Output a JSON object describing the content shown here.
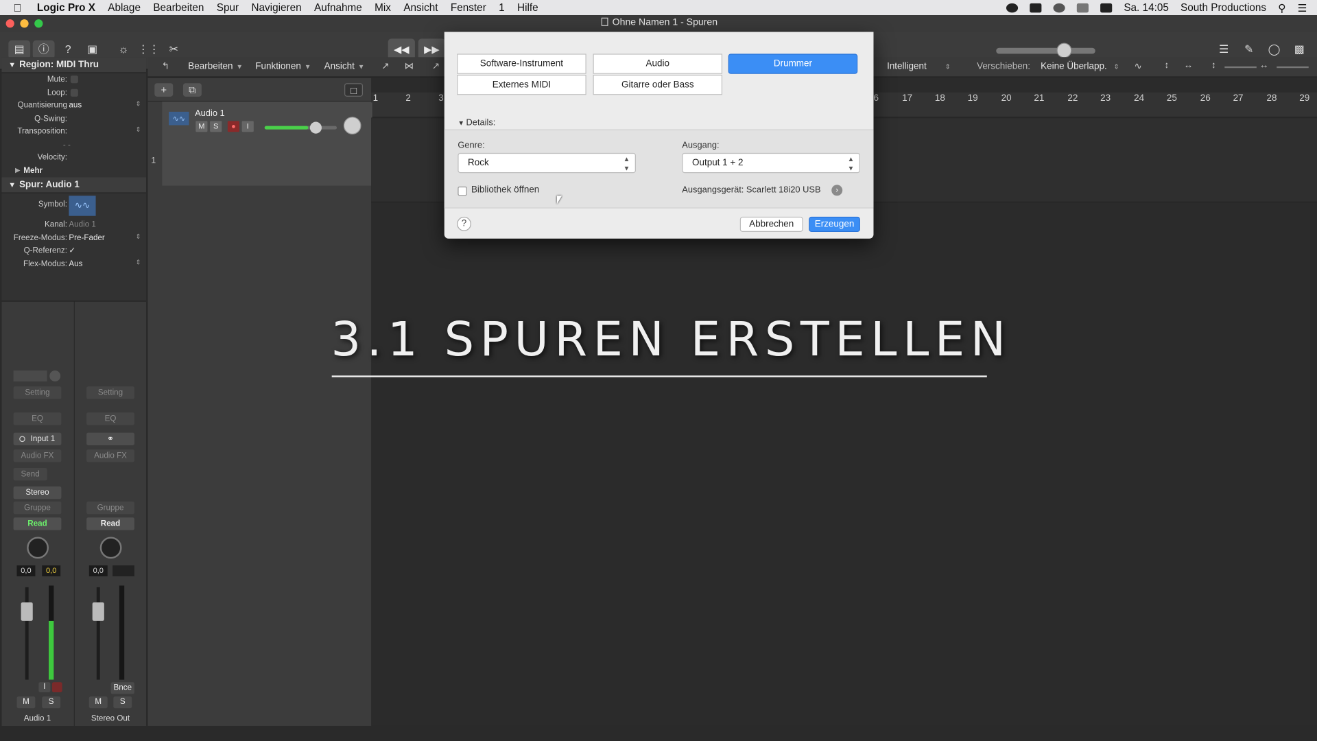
{
  "menubar": {
    "items": [
      "Logic Pro X",
      "Ablage",
      "Bearbeiten",
      "Spur",
      "Navigieren",
      "Aufnahme",
      "Mix",
      "Ansicht",
      "Fenster",
      "1",
      "Hilfe"
    ],
    "clock": "Sa. 14:05",
    "user": "South Productions"
  },
  "window": {
    "title": "Ohne Namen 1 - Spuren"
  },
  "inspector": {
    "region_header": "Region: MIDI Thru",
    "region_rows": [
      {
        "label": "Mute:",
        "value": ""
      },
      {
        "label": "Loop:",
        "value": ""
      },
      {
        "label": "Quantisierung",
        "value": "aus"
      },
      {
        "label": "Q-Swing:",
        "value": ""
      },
      {
        "label": "Transposition:",
        "value": ""
      },
      {
        "label": "",
        "value": "- -"
      },
      {
        "label": "Velocity:",
        "value": ""
      }
    ],
    "more": "Mehr",
    "track_header": "Spur: Audio 1",
    "symbol_label": "Symbol:",
    "track_rows": [
      {
        "label": "Kanal:",
        "value": "Audio 1"
      },
      {
        "label": "Freeze-Modus:",
        "value": "Pre-Fader"
      },
      {
        "label": "Q-Referenz:",
        "value": "✓"
      },
      {
        "label": "Flex-Modus:",
        "value": "Aus"
      }
    ]
  },
  "strips": {
    "setting": "Setting",
    "eq": "EQ",
    "input": "Input 1",
    "audio_fx": "Audio FX",
    "send": "Send",
    "stereo": "Stereo",
    "gruppe": "Gruppe",
    "read": "Read",
    "vol_a": "0,0",
    "pan_a": "0,0",
    "vol_b": "0,0",
    "bnce": "Bnce",
    "m": "M",
    "s": "S",
    "i": "I",
    "name_a": "Audio 1",
    "name_b": "Stereo Out"
  },
  "tracks_header": {
    "menus": [
      "Bearbeiten",
      "Funktionen",
      "Ansicht"
    ],
    "snap_value": "Intelligent",
    "drag_label": "Verschieben:",
    "drag_value": "Keine Überlapp."
  },
  "track": {
    "number": "1",
    "name": "Audio 1",
    "m": "M",
    "s": "S",
    "i": "I"
  },
  "ruler": {
    "left_bars": [
      "1",
      "2",
      "3"
    ],
    "right_bars": [
      "6",
      "17",
      "18",
      "19",
      "20",
      "21",
      "22",
      "23",
      "24",
      "25",
      "26",
      "27",
      "28",
      "29"
    ]
  },
  "overlay": {
    "title": "3.1 SPUREN ERSTELLEN"
  },
  "dialog": {
    "types": [
      "Software-Instrument",
      "Audio",
      "Drummer",
      "Externes MIDI",
      "Gitarre oder Bass"
    ],
    "details": "Details:",
    "genre_label": "Genre:",
    "genre_value": "Rock",
    "output_label": "Ausgang:",
    "output_value": "Output 1 + 2",
    "library_label": "Bibliothek öffnen",
    "output_device": "Ausgangsgerät: Scarlett 18i20 USB",
    "help": "?",
    "cancel": "Abbrechen",
    "create": "Erzeugen"
  },
  "colors": {
    "accent": "#3b8ef5",
    "read_green": "#6cf06c"
  }
}
